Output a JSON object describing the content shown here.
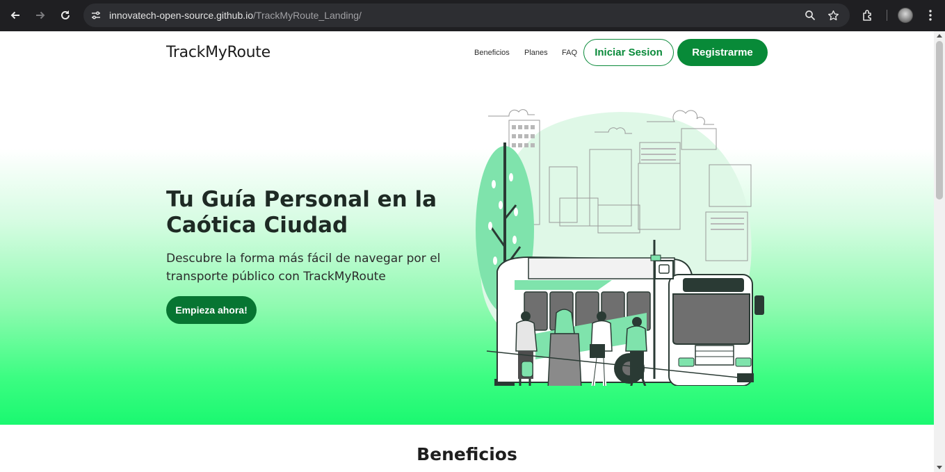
{
  "browser": {
    "url_domain": "innovatech-open-source.github.io",
    "url_path": "/TrackMyRoute_Landing/",
    "icons": [
      "back-icon",
      "forward-icon",
      "reload-icon",
      "site-settings-icon",
      "zoom-icon",
      "bookmark-star-icon",
      "extensions-icon",
      "profile-avatar",
      "menu-kebab-icon"
    ]
  },
  "header": {
    "logo": "TrackMyRoute",
    "nav": [
      "Beneficios",
      "Planes",
      "FAQ"
    ],
    "login_label": "Iniciar Sesion",
    "register_label": "Registrarme"
  },
  "hero": {
    "title": "Tu Guía Personal en la Caótica Ciudad",
    "subtitle": "Descubre la forma más fácil de navegar por el transporte público con TrackMyRoute",
    "cta_label": "Empieza ahora!",
    "illustration": "bus-stop-illustration"
  },
  "benefits": {
    "title": "Beneficios"
  },
  "colors": {
    "brand_green": "#088a38",
    "hero_gradient_end": "#1af870",
    "chrome_bg": "#1f1f22"
  }
}
